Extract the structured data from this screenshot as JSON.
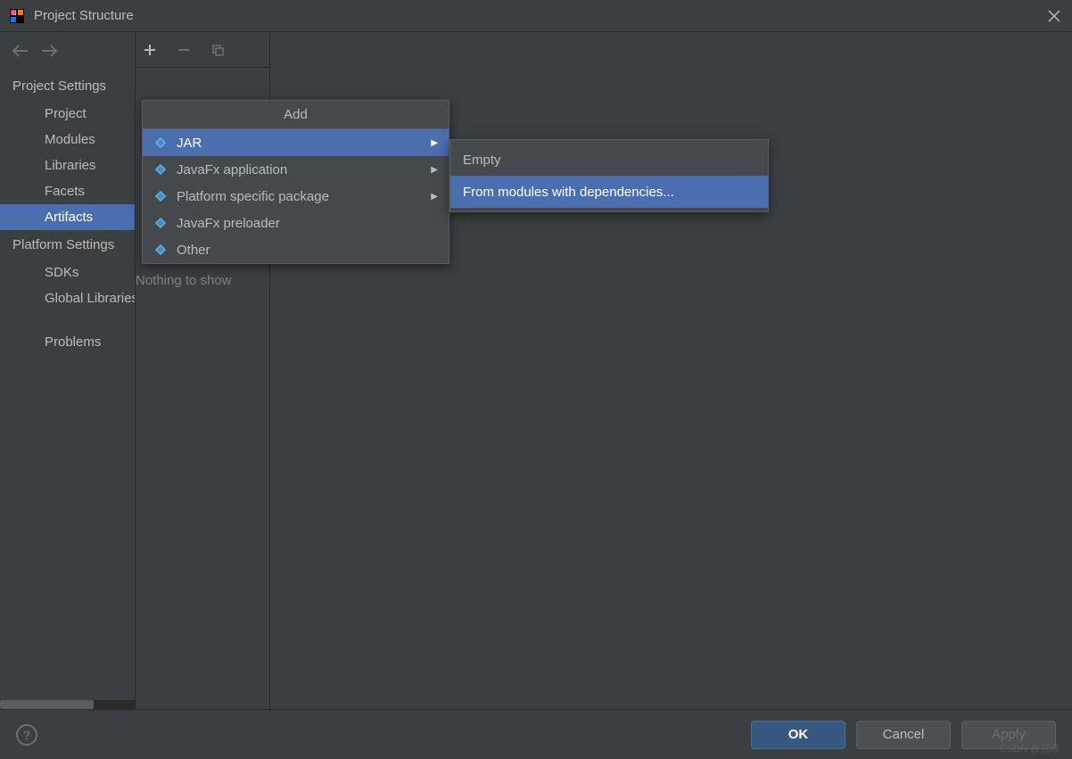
{
  "window": {
    "title": "Project Structure"
  },
  "sidebar": {
    "section1": "Project Settings",
    "items1": [
      {
        "label": "Project"
      },
      {
        "label": "Modules"
      },
      {
        "label": "Libraries"
      },
      {
        "label": "Facets"
      },
      {
        "label": "Artifacts"
      }
    ],
    "section2": "Platform Settings",
    "items2": [
      {
        "label": "SDKs"
      },
      {
        "label": "Global Libraries"
      }
    ],
    "section3_item": "Problems"
  },
  "column2": {
    "empty_text": "Nothing to show"
  },
  "add_menu": {
    "header": "Add",
    "items": [
      {
        "label": "JAR",
        "has_submenu": true,
        "selected": true
      },
      {
        "label": "JavaFx application",
        "has_submenu": true
      },
      {
        "label": "Platform specific package",
        "has_submenu": true
      },
      {
        "label": "JavaFx preloader"
      },
      {
        "label": "Other"
      }
    ]
  },
  "jar_submenu": {
    "items": [
      {
        "label": "Empty"
      },
      {
        "label": "From modules with dependencies...",
        "selected": true
      }
    ]
  },
  "footer": {
    "ok": "OK",
    "cancel": "Cancel",
    "apply": "Apply"
  },
  "watermark": "CSDN @沉泽·"
}
